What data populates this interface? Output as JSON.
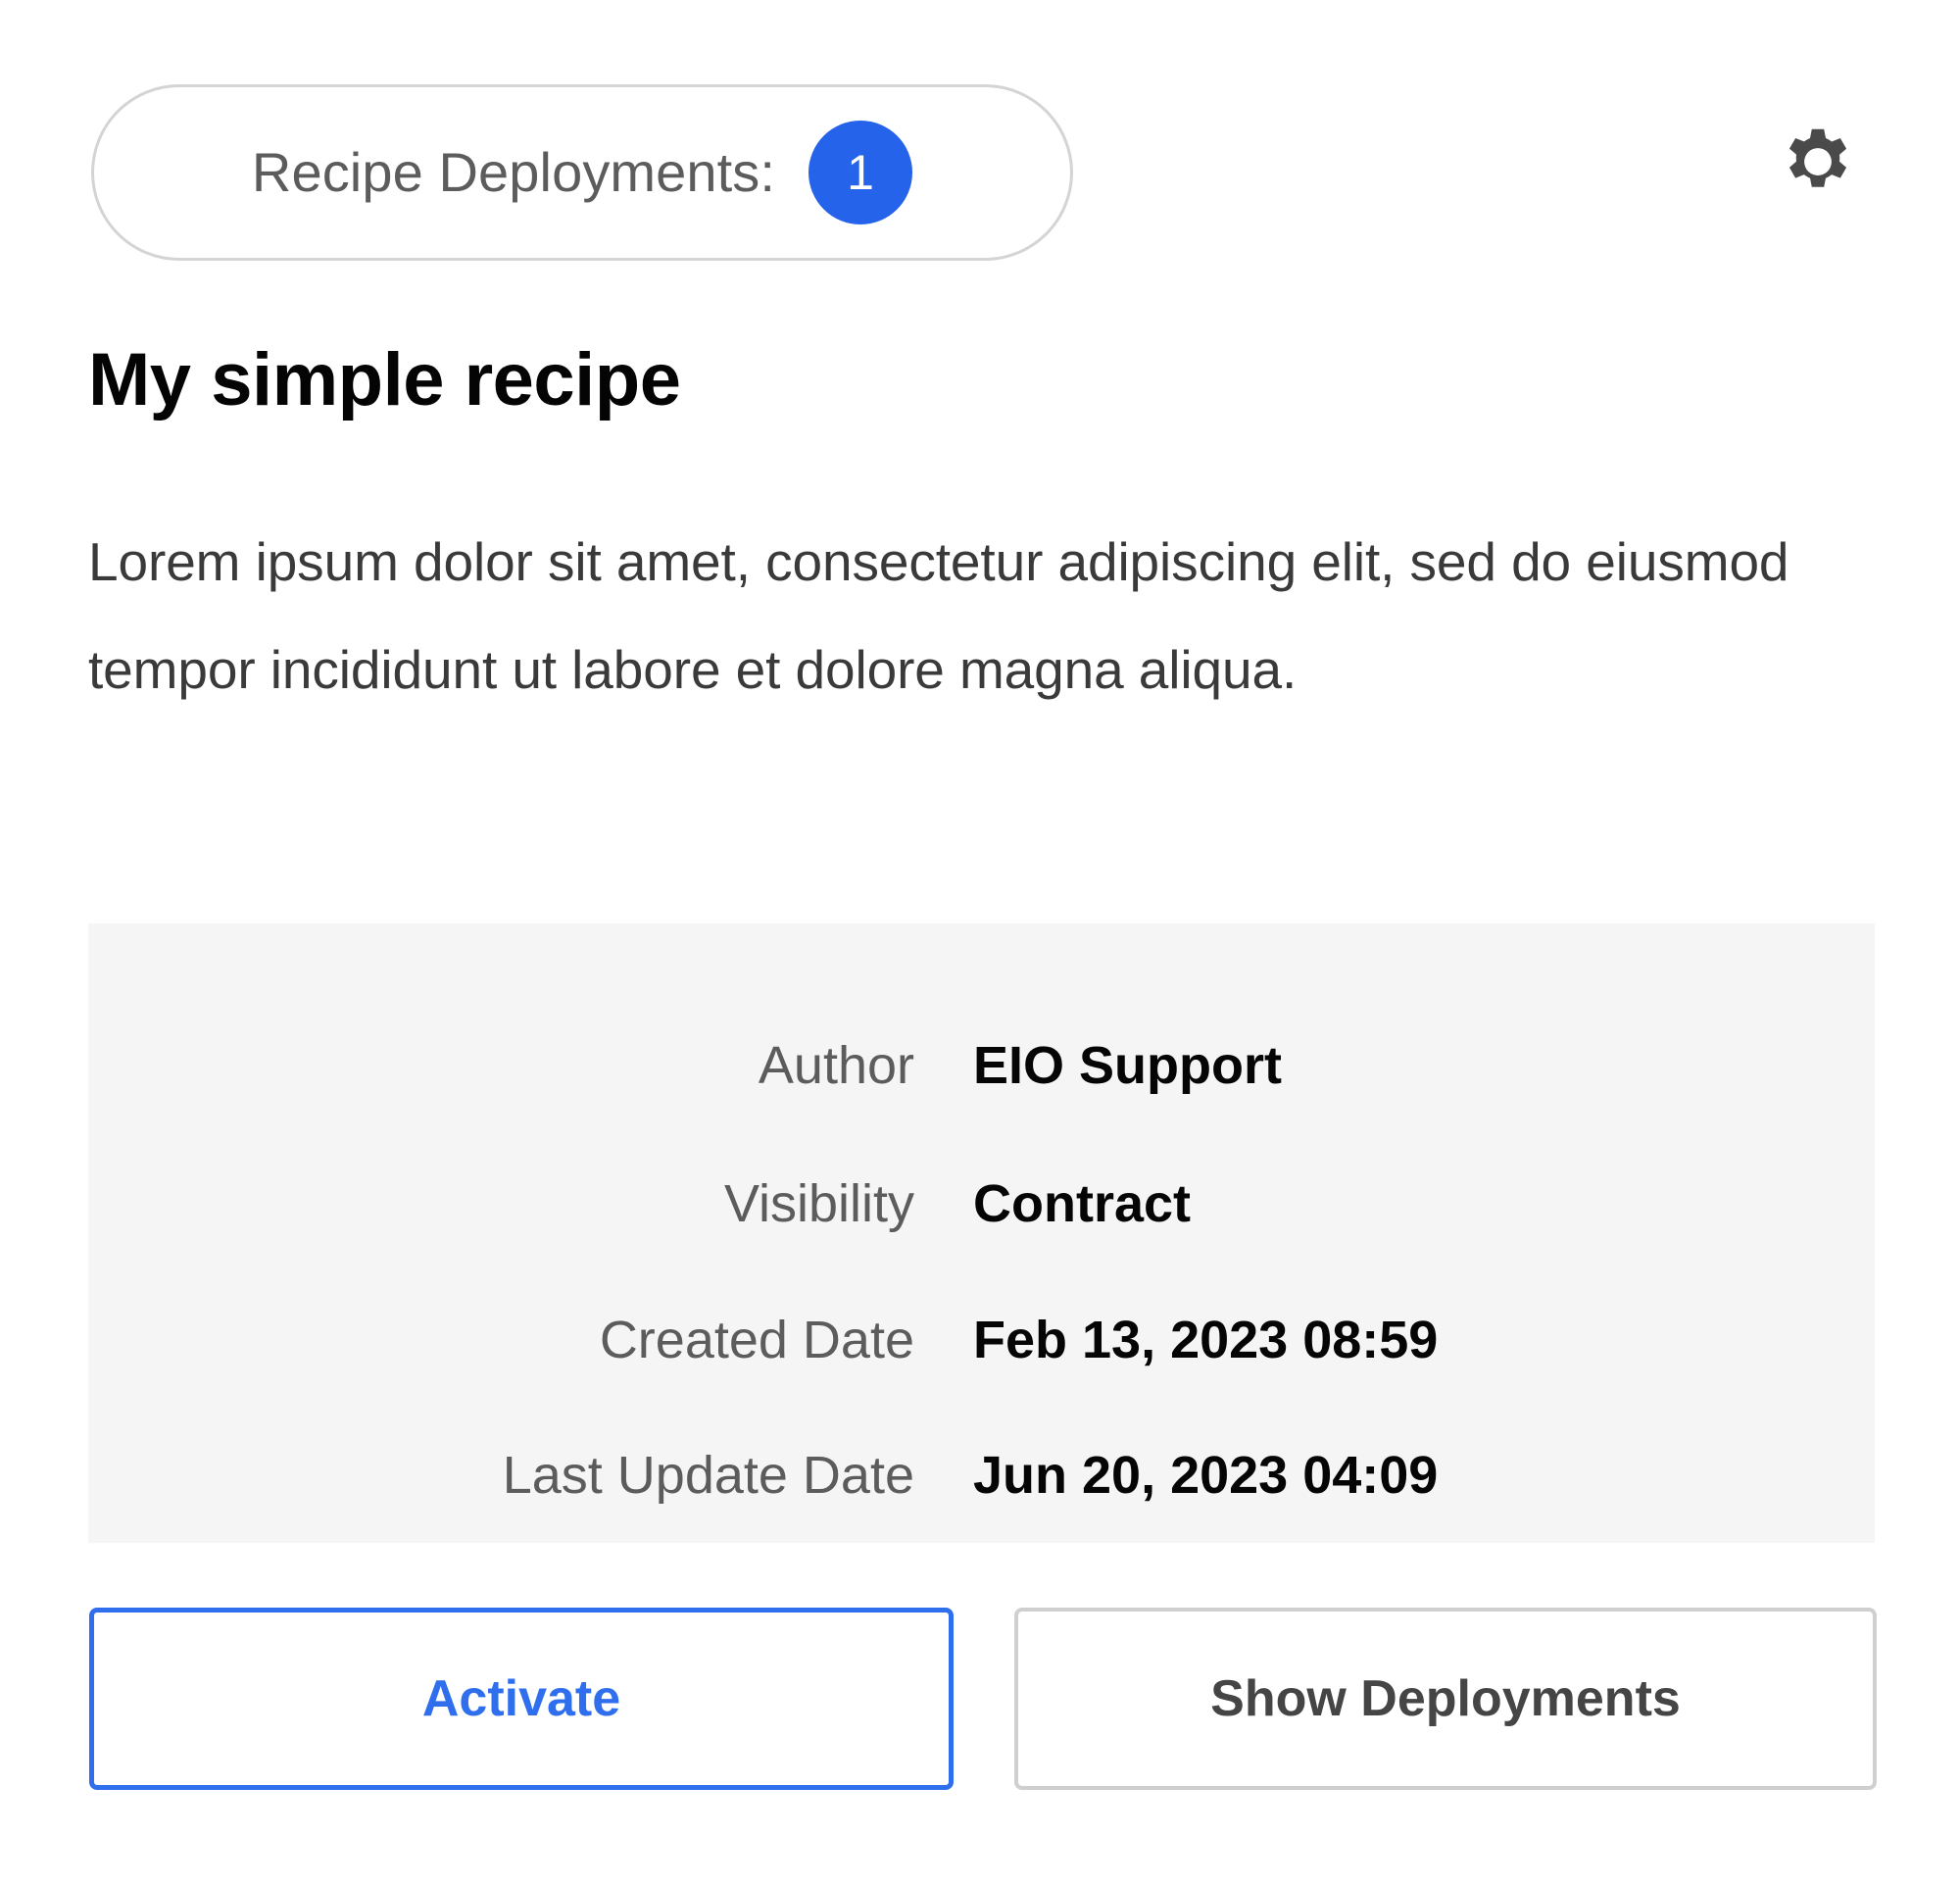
{
  "header": {
    "deployments_pill": {
      "label": "Recipe Deployments:",
      "count": "1",
      "badge_color": "#2563eb"
    },
    "settings_icon": "gear-icon"
  },
  "recipe": {
    "title": "My simple recipe",
    "description": "Lorem ipsum dolor sit amet, consectetur adipiscing elit, sed do eiusmod tempor incididunt ut labore et dolore magna aliqua."
  },
  "details": {
    "rows": [
      {
        "label": "Author",
        "value": "EIO Support"
      },
      {
        "label": "Visibility",
        "value": "Contract"
      },
      {
        "label": "Created Date",
        "value": "Feb 13, 2023 08:59"
      },
      {
        "label": "Last Update Date",
        "value": "Jun 20, 2023 04:09"
      }
    ]
  },
  "actions": {
    "activate_label": "Activate",
    "show_deployments_label": "Show Deployments",
    "primary_color": "#2f6fed"
  }
}
